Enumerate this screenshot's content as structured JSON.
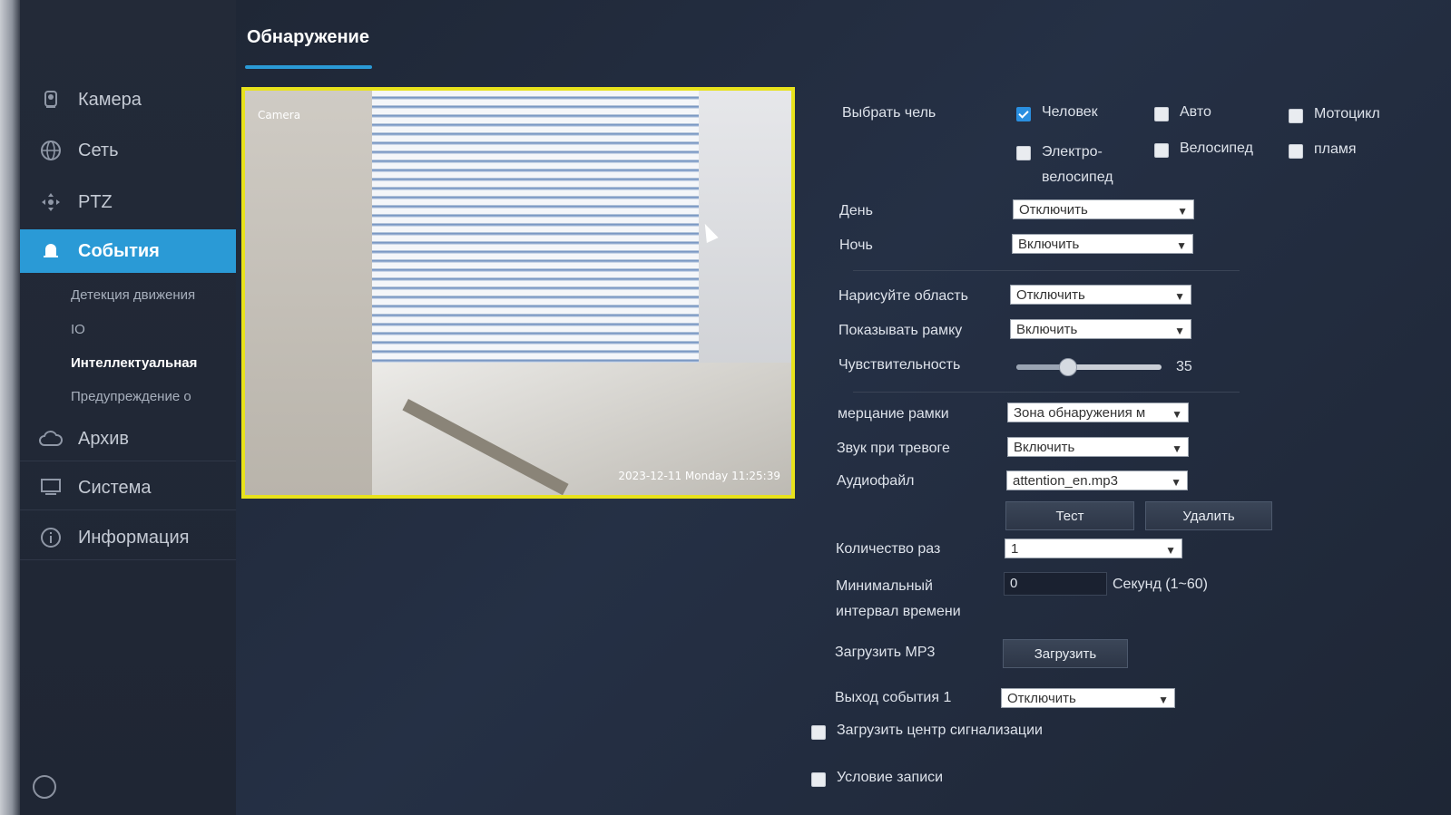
{
  "sidebar": {
    "items": [
      {
        "label": "Камера",
        "icon": "camera-icon"
      },
      {
        "label": "Сеть",
        "icon": "globe-icon"
      },
      {
        "label": "PTZ",
        "icon": "ptz-icon"
      },
      {
        "label": "События",
        "icon": "bell-icon"
      },
      {
        "label": "Архив",
        "icon": "cloud-icon"
      },
      {
        "label": "Система",
        "icon": "monitor-icon"
      },
      {
        "label": "Информация",
        "icon": "info-icon"
      }
    ],
    "sub_items": [
      "Детекция движения",
      "IO",
      "Интеллектуальная",
      "Предупреждение о"
    ]
  },
  "tab": {
    "title": "Обнаружение"
  },
  "video": {
    "label": "Camera",
    "timestamp": "2023-12-11 Monday 11:25:39"
  },
  "form": {
    "target_label": "Выбрать чель",
    "targets": [
      {
        "label": "Человек",
        "checked": true
      },
      {
        "label": "Авто",
        "checked": false
      },
      {
        "label": "Мотоцикл",
        "checked": false
      },
      {
        "label": "Электро-\nвелосипед",
        "checked": false
      },
      {
        "label": "Велосипед",
        "checked": false
      },
      {
        "label": "пламя",
        "checked": false
      }
    ],
    "day_label": "День",
    "day_value": "Отключить",
    "night_label": "Ночь",
    "night_value": "Включить",
    "draw_area_label": "Нарисуйте область",
    "draw_area_value": "Отключить",
    "show_frame_label": "Показывать рамку",
    "show_frame_value": "Включить",
    "sensitivity_label": "Чувствительность",
    "sensitivity_value": "35",
    "sensitivity_fraction": 0.35,
    "flicker_label": "мерцание рамки",
    "flicker_value": "Зона обнаружения м",
    "alarm_sound_label": "Звук при тревоге",
    "alarm_sound_value": "Включить",
    "audio_file_label": "Аудиофайл",
    "audio_file_value": "attention_en.mp3",
    "test_button": "Тест",
    "delete_button": "Удалить",
    "count_label": "Количество раз",
    "count_value": "1",
    "min_interval_label": "Минимальный\nинтервал времени",
    "min_interval_value": "0",
    "min_interval_unit": "Секунд (1~60)",
    "upload_mp3_label": "Загрузить MP3",
    "upload_button": "Загрузить",
    "event_output_label": "Выход события 1",
    "event_output_value": "Отключить",
    "upload_alarm_center_label": "Загрузить центр сигнализации",
    "record_condition_label": "Условие записи"
  }
}
